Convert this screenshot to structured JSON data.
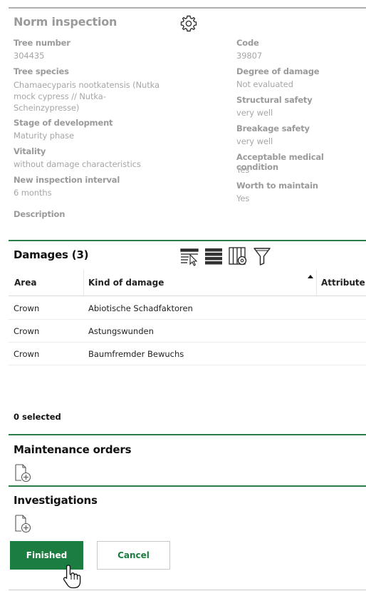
{
  "norm_inspection": {
    "title": "Norm inspection",
    "settings_icon": "gear-icon",
    "left": {
      "tree_number_label": "Tree number",
      "tree_number": "304435",
      "tree_species_label": "Tree species",
      "tree_species_line1": "Chamaecyparis nootkatensis (Nutka",
      "tree_species_line2": "mock cypress // Nutka-",
      "tree_species_line3": "Scheinzypresse)",
      "stage_label": "Stage of development",
      "stage": "Maturity phase",
      "vitality_label": "Vitality",
      "vitality": "without damage characteristics",
      "interval_label": "New inspection interval",
      "interval": "6 months",
      "description_label": "Description"
    },
    "right": {
      "code_label": "Code",
      "code": "39807",
      "degree_label": "Degree of damage",
      "degree": "Not evaluated",
      "structural_label": "Structural safety",
      "structural": "very well",
      "breakage_label": "Breakage safety",
      "breakage": "very well",
      "medical_label": "Acceptable medical condition",
      "medical": "Yes",
      "worth_label": "Worth to maintain",
      "worth": "Yes"
    }
  },
  "damages": {
    "title": "Damages (3)",
    "toolbar_icons": [
      "select-cursor-icon",
      "list-rows-icon",
      "column-settings-icon",
      "filter-funnel-icon"
    ],
    "columns": [
      "Area",
      "Kind of damage",
      "Attribute"
    ],
    "rows": [
      {
        "area": "Crown",
        "kind": "Abiotische Schadfaktoren",
        "attribute": ""
      },
      {
        "area": "Crown",
        "kind": "Astungswunden",
        "attribute": ""
      },
      {
        "area": "Crown",
        "kind": "Baumfremder Bewuchs",
        "attribute": ""
      }
    ],
    "selected_text": "0 selected"
  },
  "maintenance_orders": {
    "title": "Maintenance orders",
    "add_icon": "add-document-icon"
  },
  "investigations": {
    "title": "Investigations",
    "add_icon": "add-document-icon"
  },
  "actions": {
    "finished_label": "Finished",
    "cancel_label": "Cancel"
  },
  "colors": {
    "accent_green": "#1b7d3f",
    "section_rule": "#2a7d48",
    "muted_text": "#9a9a9a"
  }
}
